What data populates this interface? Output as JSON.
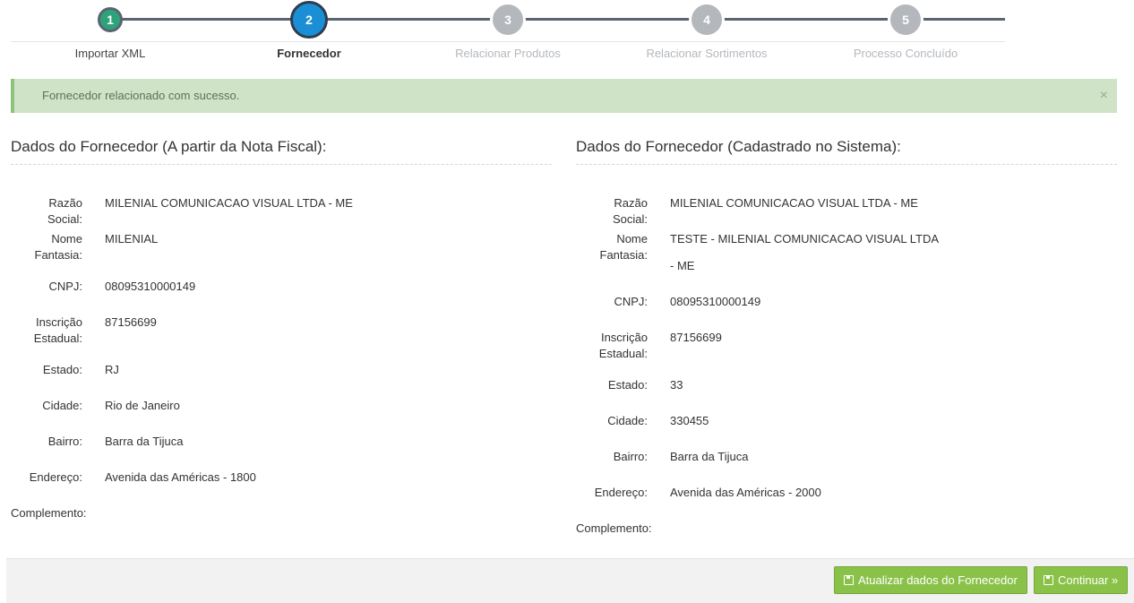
{
  "wizard": {
    "steps": [
      {
        "number": "1",
        "label": "Importar XML",
        "state": "done"
      },
      {
        "number": "2",
        "label": "Fornecedor",
        "state": "active"
      },
      {
        "number": "3",
        "label": "Relacionar Produtos",
        "state": "todo"
      },
      {
        "number": "4",
        "label": "Relacionar Sortimentos",
        "state": "todo"
      },
      {
        "number": "5",
        "label": "Processo Concluído",
        "state": "todo"
      }
    ]
  },
  "alert": {
    "message": "Fornecedor relacionado com sucesso.",
    "close": "×"
  },
  "left_panel": {
    "title": "Dados do Fornecedor (A partir da Nota Fiscal):",
    "fields": [
      {
        "label": "Razão Social:",
        "value": "MILENIAL COMUNICACAO VISUAL LTDA - ME"
      },
      {
        "label": "Nome Fantasia:",
        "value": "MILENIAL"
      },
      {
        "label": "CNPJ:",
        "value": "08095310000149"
      },
      {
        "label": "Inscrição Estadual:",
        "value": "87156699"
      },
      {
        "label": "Estado:",
        "value": "RJ"
      },
      {
        "label": "Cidade:",
        "value": "Rio de Janeiro"
      },
      {
        "label": "Bairro:",
        "value": "Barra da Tijuca"
      },
      {
        "label": "Endereço:",
        "value": "Avenida das Américas - 1800"
      },
      {
        "label": "Complemento:",
        "value": ""
      }
    ]
  },
  "right_panel": {
    "title": "Dados do Fornecedor (Cadastrado no Sistema):",
    "fields": [
      {
        "label": "Razão Social:",
        "value": "MILENIAL COMUNICACAO VISUAL LTDA - ME"
      },
      {
        "label": "Nome Fantasia:",
        "value": "TESTE - MILENIAL COMUNICACAO VISUAL LTDA - ME"
      },
      {
        "label": "CNPJ:",
        "value": "08095310000149"
      },
      {
        "label": "Inscrição Estadual:",
        "value": "87156699"
      },
      {
        "label": "Estado:",
        "value": "33"
      },
      {
        "label": "Cidade:",
        "value": "330455"
      },
      {
        "label": "Bairro:",
        "value": "Barra da Tijuca"
      },
      {
        "label": "Endereço:",
        "value": "Avenida das Américas - 2000"
      },
      {
        "label": "Complemento:",
        "value": ""
      }
    ]
  },
  "footer": {
    "update_button": "Atualizar dados do Fornecedor",
    "continue_button": "Continuar »",
    "save_icon": "save-icon"
  },
  "colors": {
    "step_done": "#2ea37a",
    "step_active": "#1a8fd6",
    "step_todo": "#b4b8bd",
    "alert_bg": "#cfe3c7",
    "button_green": "#8ac249"
  }
}
